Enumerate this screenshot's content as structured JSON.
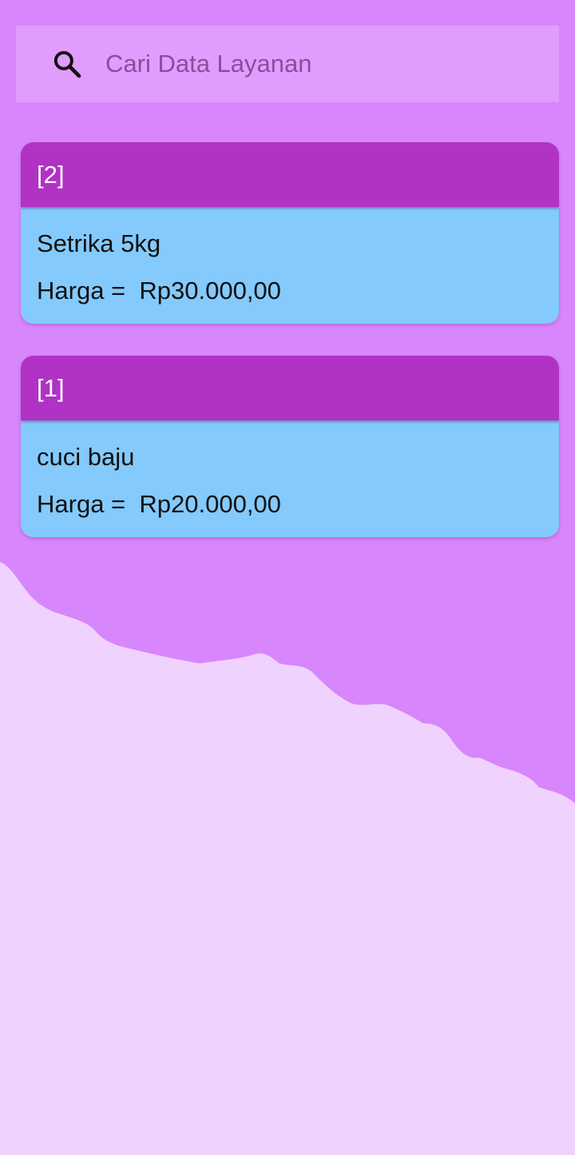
{
  "search": {
    "placeholder": "Cari Data Layanan",
    "icon": "search-icon"
  },
  "services": [
    {
      "id_label": "[2]",
      "name": "Setrika 5kg",
      "price_label": "Harga =  Rp30.000,00"
    },
    {
      "id_label": "[1]",
      "name": "cuci baju",
      "price_label": "Harga =  Rp20.000,00"
    }
  ],
  "colors": {
    "background": "#d886fc",
    "wave": "#efd2fd",
    "search_bar": "#e09dfd",
    "card_header": "#b033c5",
    "card_body": "#84cafc"
  }
}
